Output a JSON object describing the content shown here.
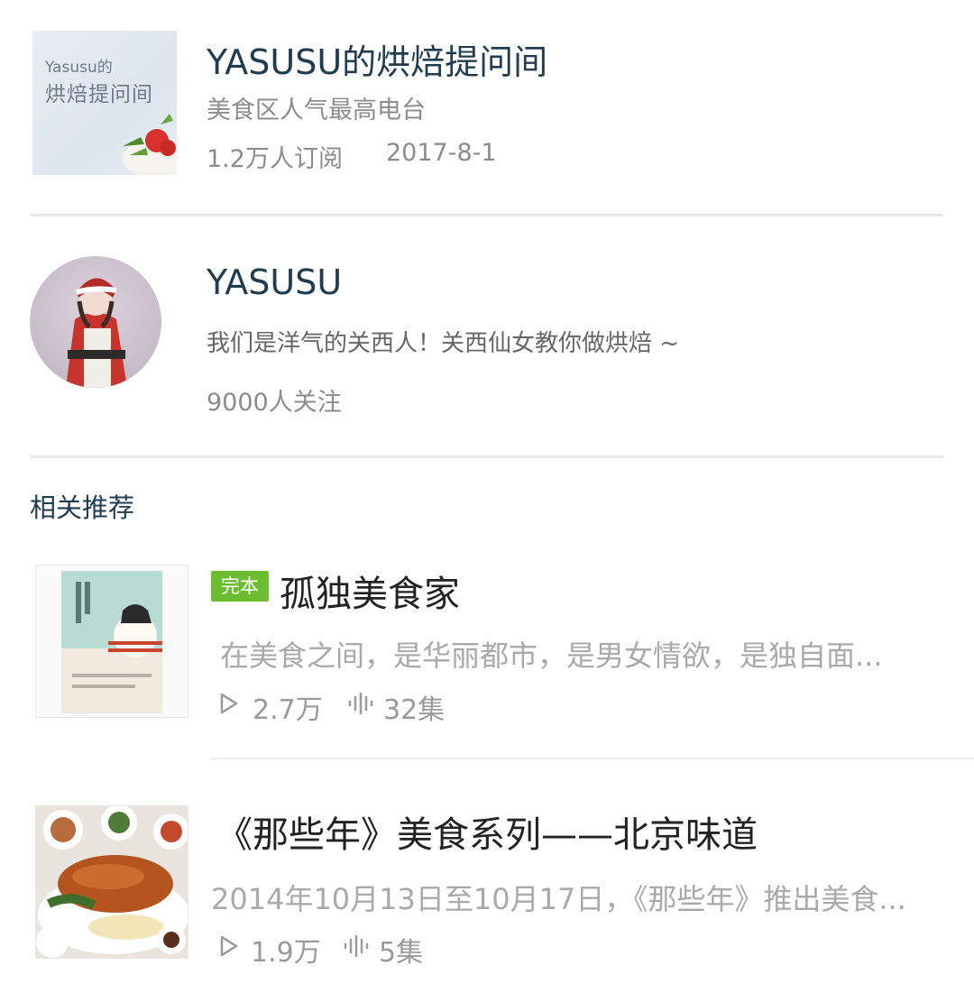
{
  "radio": {
    "cover_text_line1": "Yasusu的",
    "cover_text_line2": "烘焙提问间",
    "title": "YASUSU的烘焙提问间",
    "subtitle": "美食区人气最高电台",
    "subscribers": "1.2万人订阅",
    "date": "2017-8-1"
  },
  "author": {
    "name": "YASUSU",
    "bio": "我们是洋气的关西人！关西仙女教你做烘焙 ~",
    "followers": "9000人关注"
  },
  "recommend": {
    "section_title": "相关推荐",
    "items": [
      {
        "badge": "完本",
        "title": "孤独美食家",
        "description": "在美食之间，是华丽都市，是男女情欲，是独自面...",
        "plays": "2.7万",
        "episodes": "32集",
        "play_icon": "play-icon",
        "episodes_icon": "audio-wave-icon"
      },
      {
        "title": "《那些年》美食系列——北京味道",
        "description": "2014年10月13日至10月17日，《那些年》推出美食...",
        "plays": "1.9万",
        "episodes": "5集",
        "play_icon": "play-icon",
        "episodes_icon": "audio-wave-icon"
      }
    ]
  },
  "colors": {
    "title_dark": "#1f3c50",
    "badge_green": "#6bbd2f",
    "muted_text": "#8c8c8c"
  }
}
